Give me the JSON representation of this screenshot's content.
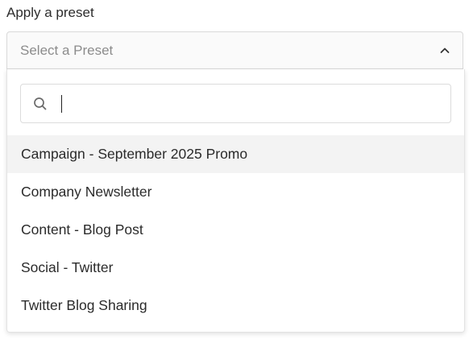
{
  "field": {
    "label": "Apply a preset",
    "placeholder": "Select a Preset",
    "expanded": true,
    "chevron_icon": "chevron-up-icon"
  },
  "search": {
    "value": "",
    "placeholder": "",
    "icon": "search-icon"
  },
  "options": [
    {
      "label": "Campaign - September 2025 Promo",
      "highlighted": true
    },
    {
      "label": "Company Newsletter",
      "highlighted": false
    },
    {
      "label": "Content - Blog Post",
      "highlighted": false
    },
    {
      "label": "Social - Twitter",
      "highlighted": false
    },
    {
      "label": "Twitter Blog Sharing",
      "highlighted": false
    }
  ],
  "colors": {
    "highlight": "#f3f3f3",
    "placeholder_text": "#8c8c8c",
    "border": "#d9d9d9"
  }
}
